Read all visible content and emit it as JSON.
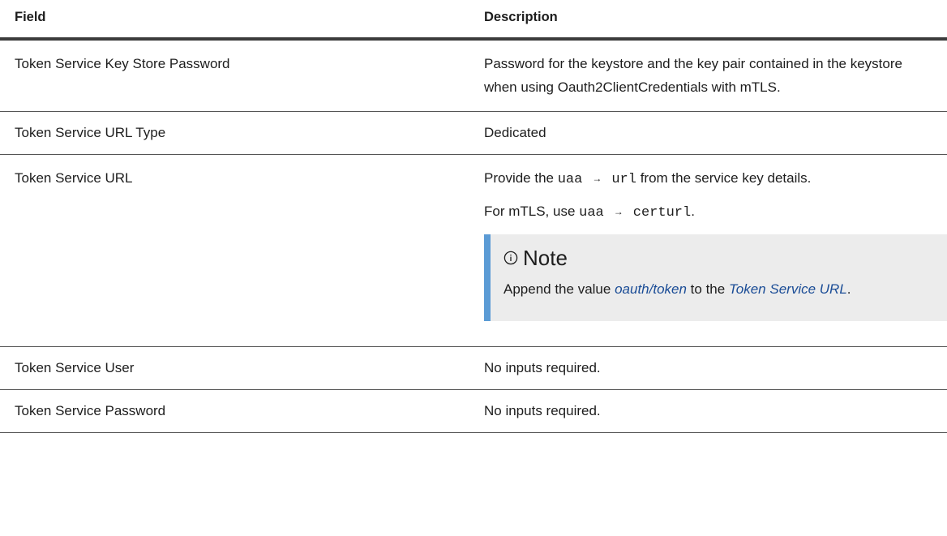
{
  "headers": {
    "field": "Field",
    "description": "Description"
  },
  "rows": [
    {
      "field": "Token Service Key Store Password",
      "description": "Password for the keystore and the key pair contained in the keystore when using Oauth2ClientCredentials with mTLS."
    },
    {
      "field": "Token Service URL Type",
      "description": "Dedicated"
    },
    {
      "field": "Token Service URL",
      "line1_prefix": "Provide the",
      "line1_code1": "uaa",
      "line1_arrow": "→",
      "line1_code2": "url",
      "line1_suffix": "from the service key details.",
      "line2_prefix": "For mTLS, use",
      "line2_code1": "uaa",
      "line2_arrow": "→",
      "line2_code2": "certurl",
      "line2_suffix": ".",
      "note": {
        "icon": "info-circle-icon",
        "title": "Note",
        "text_before": "Append the value",
        "link1": "oauth/token",
        "text_middle": "to the",
        "link2": "Token Service URL",
        "text_after": "."
      }
    },
    {
      "field": "Token Service User",
      "description": "No inputs required."
    },
    {
      "field": "Token Service Password",
      "description": "No inputs required."
    }
  ],
  "colors": {
    "note_accent": "#5b9bd5",
    "note_background": "#ececec",
    "link": "#1a4c96"
  }
}
